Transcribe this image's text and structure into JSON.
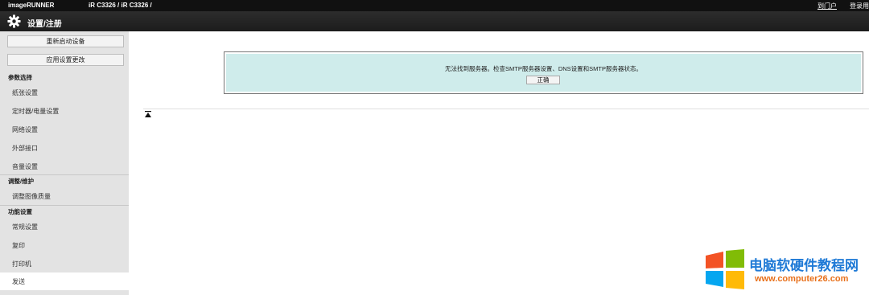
{
  "topbar": {
    "brand": "imageRUNNER",
    "device": "iR C3326 / iR C3326 /",
    "portal_link": "到门户",
    "login_link": "登录用"
  },
  "header": {
    "title": "设置/注册",
    "icon": "gear-icon"
  },
  "sidebar": {
    "buttons": [
      {
        "label": "重新启动设备"
      },
      {
        "label": "应用设置更改"
      }
    ],
    "sections": [
      {
        "title": "参数选择",
        "items": [
          "纸张设置",
          "定时器/电量设置",
          "网络设置",
          "外部接口",
          "音量设置"
        ]
      },
      {
        "title": "调整/维护",
        "items": [
          "调整图像质量"
        ]
      },
      {
        "title": "功能设置",
        "items": [
          "常规设置",
          "复印",
          "打印机",
          "发送"
        ]
      }
    ],
    "selected_item": "发送"
  },
  "alert": {
    "message": "无法找到服务器。检查SMTP服务器设置、DNS设置和SMTP服务器状态。",
    "ok_label": "正确"
  },
  "watermark": {
    "name": "电脑软硬件教程网",
    "url": "www.computer26.com",
    "colors": {
      "red": "#f35325",
      "green": "#81bc06",
      "blue": "#05a6f0",
      "yellow": "#ffba08"
    }
  }
}
